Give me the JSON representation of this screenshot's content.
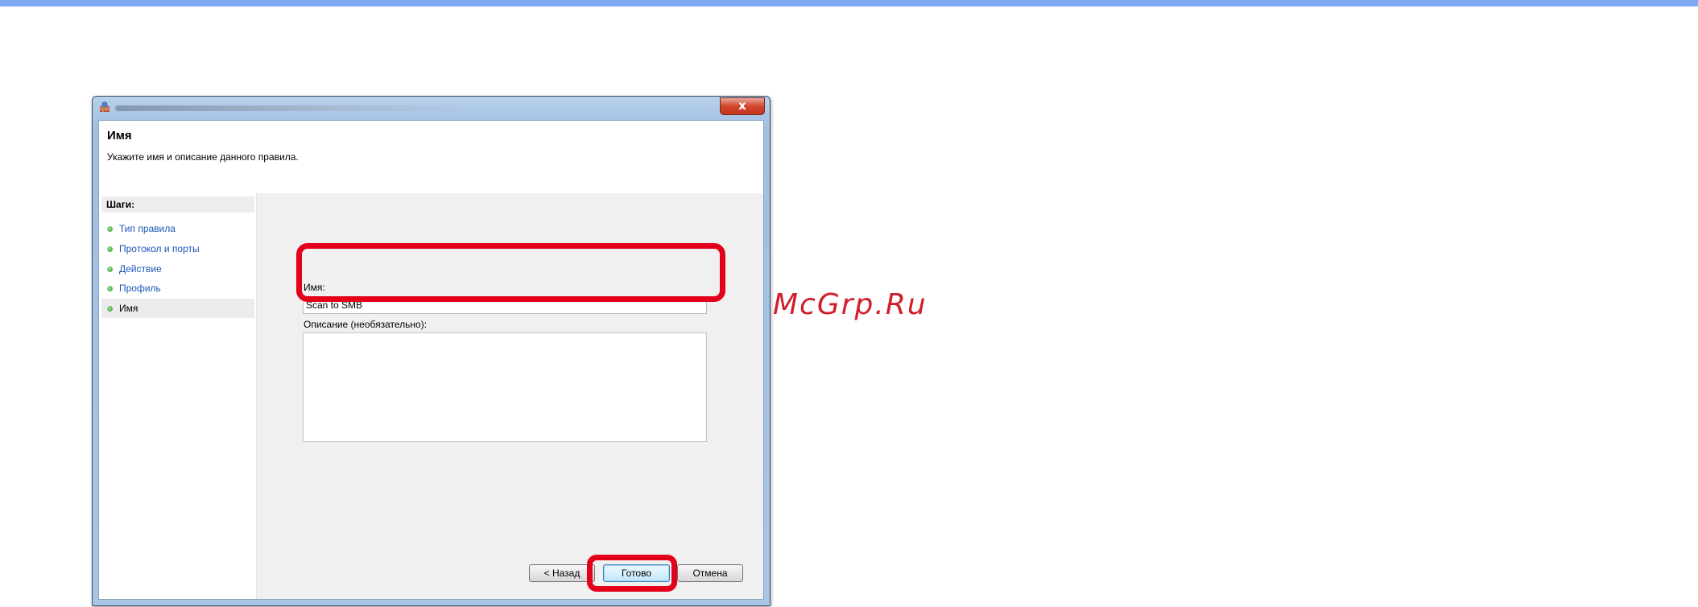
{
  "window": {
    "close_glyph": "x",
    "header": {
      "title": "Имя",
      "subtitle": "Укажите имя и описание данного правила."
    },
    "steps": {
      "heading": "Шаги:",
      "items": [
        {
          "label": "Тип правила"
        },
        {
          "label": "Протокол и порты"
        },
        {
          "label": "Действие"
        },
        {
          "label": "Профиль"
        },
        {
          "label": "Имя"
        }
      ],
      "current_index": 4
    },
    "form": {
      "name_label": "Имя:",
      "name_value": "Scan to SMB",
      "description_label": "Описание (необязательно):",
      "description_value": ""
    },
    "buttons": {
      "back": "< Назад",
      "finish": "Готово",
      "cancel": "Отмена"
    }
  },
  "watermark": "McGrp.Ru",
  "colors": {
    "highlight": "#e3001b",
    "link": "#1a55b8",
    "accent_bar": "#7faaf1"
  }
}
